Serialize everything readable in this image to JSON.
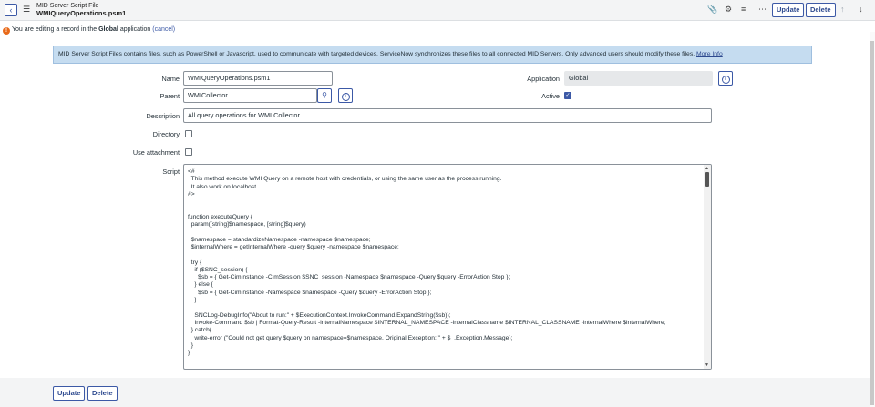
{
  "header": {
    "back_icon": "chevron-left-icon",
    "menu_icon": "hamburger-icon",
    "title_line1": "MID Server Script File",
    "title_line2": "WMIQueryOperations.psm1",
    "icons": [
      "paperclip-icon",
      "sliders-icon",
      "filter-icon",
      "more-icon"
    ],
    "update_label": "Update",
    "delete_label": "Delete"
  },
  "notice": {
    "prefix": "You are editing a record in the ",
    "app": "Global",
    "suffix": " application ",
    "cancel_label": "(cancel)"
  },
  "banner": {
    "text": "MID Server Script Files contains files, such as PowerShell or Javascript, used to communicate with targeted devices. ServiceNow synchronizes these files to all connected MID Servers. Only advanced users should modify these files. ",
    "link_label": "More Info"
  },
  "form": {
    "name_label": "Name",
    "name_value": "WMIQueryOperations.psm1",
    "parent_label": "Parent",
    "parent_value": "WMICollector",
    "description_label": "Description",
    "description_value": "All query operations for WMI Collector",
    "directory_label": "Directory",
    "directory_checked": false,
    "use_attachment_label": "Use attachment",
    "use_attachment_checked": false,
    "application_label": "Application",
    "application_value": "Global",
    "active_label": "Active",
    "active_checked": true,
    "script_label": "Script",
    "script_value": "<#\n  This method execute WMI Query on a remote host with credentials, or using the same user as the process running.\n  It also work on localhost\n#>\n\n\nfunction executeQuery {\n  param([string]$namespace, [string]$query)\n\n  $namespace = standardizeNamespace -namespace $namespace;\n  $internalWhere = getInternalWhere -query $query -namespace $namespace;\n\n  try {\n    if ($SNC_session) {\n      $sb = { Get-CimInstance -CimSession $SNC_session -Namespace $namespace -Query $query -ErrorAction Stop };\n    } else {\n      $sb = { Get-CimInstance -Namespace $namespace -Query $query -ErrorAction Stop };\n    }\n\n    SNCLog-DebugInfo(\"About to run:\" + $ExecutionContext.InvokeCommand.ExpandString($sb));\n    Invoke-Command $sb | Format-Query-Result -internalNamespace $INTERNAL_NAMESPACE -internalClassname $INTERNAL_CLASSNAME -internalWhere $internalWhere;\n  } catch{\n    write-error (\"Could not get query $query on namespace=$namespace. Original Exception: \" + $_.Exception.Message);\n  }\n}"
  },
  "footer": {
    "update_label": "Update",
    "delete_label": "Delete"
  }
}
